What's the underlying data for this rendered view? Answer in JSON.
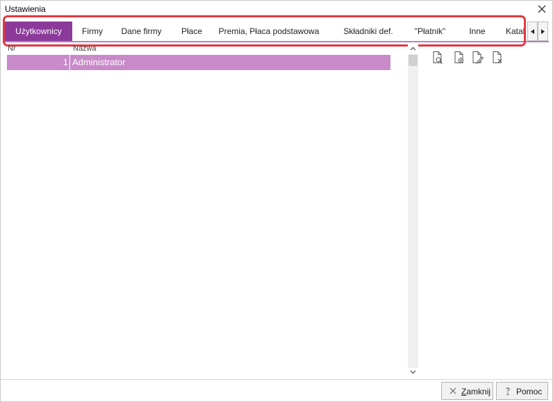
{
  "window": {
    "title": "Ustawienia"
  },
  "tabs": [
    {
      "label": "Użytkownicy",
      "active": true
    },
    {
      "label": "Firmy"
    },
    {
      "label": "Dane firmy"
    },
    {
      "label": "Płace"
    },
    {
      "label": "Premia, Płaca podstawowa"
    },
    {
      "label": "Składniki def."
    },
    {
      "label": "\"Płatnik\""
    },
    {
      "label": "Inne"
    },
    {
      "label": "Katal"
    }
  ],
  "grid": {
    "columns": {
      "nr": "Nr",
      "name": "Nazwa"
    },
    "rows": [
      {
        "nr": "1",
        "name": "Administrator"
      }
    ]
  },
  "toolbar": {
    "icons": [
      "document-preview-icon",
      "document-add-icon",
      "document-edit-icon",
      "document-delete-icon"
    ]
  },
  "footer": {
    "close_label_first": "Z",
    "close_label_rest": "amknij",
    "help_label": "Pomoc"
  },
  "colors": {
    "accent": "#8b3a9a",
    "selected_row": "#c88ac9",
    "highlight": "#e0393e"
  }
}
